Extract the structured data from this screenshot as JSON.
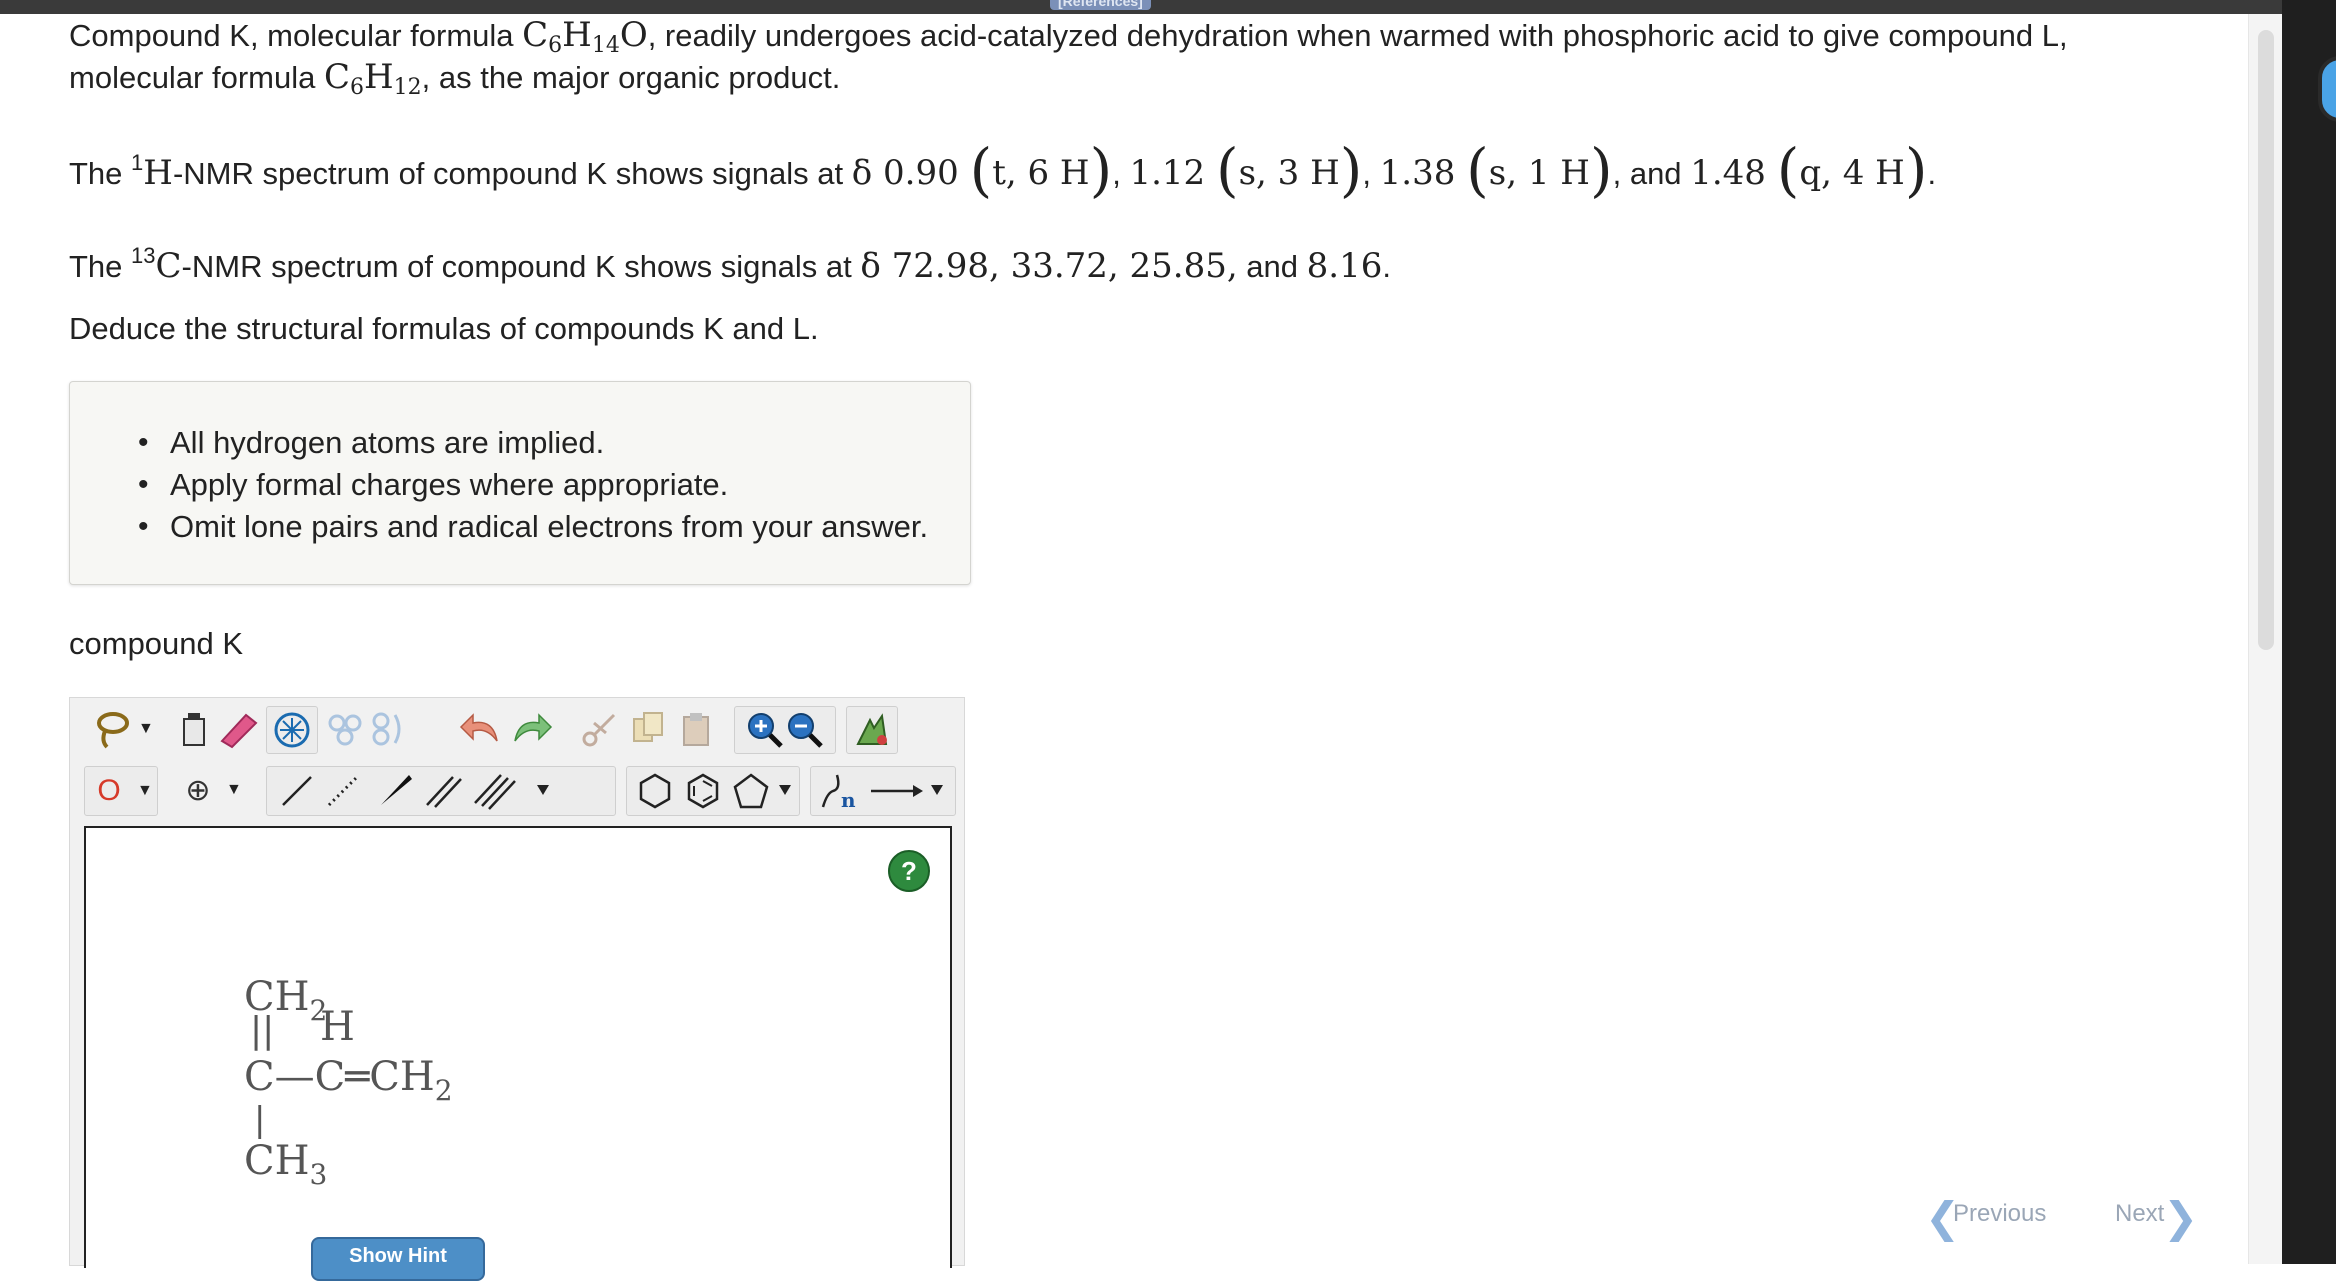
{
  "header": {
    "tab_label": "[References]"
  },
  "question": {
    "line1_a": "Compound K, molecular formula ",
    "line1_formula_C": "C",
    "line1_formula_C_sub": "6",
    "line1_formula_H": "H",
    "line1_formula_H_sub": "14",
    "line1_formula_O": "O",
    "line1_b": ", readily undergoes acid-catalyzed dehydration when warmed with phosphoric acid to give compound L,",
    "line2_a": "molecular formula ",
    "line2_formula_C": "C",
    "line2_formula_C_sub": "6",
    "line2_formula_H": "H",
    "line2_formula_H_sub": "12",
    "line2_b": ", as the major organic product.",
    "hnmr_prefix": "The ",
    "hnmr_sup": "1",
    "hnmr_nucleus": "H",
    "hnmr_text": "-NMR spectrum of compound K shows signals at ",
    "hnmr_signals": [
      {
        "shift": "δ 0.90",
        "mult": "t, 6 H"
      },
      {
        "shift": "1.12",
        "mult": "s, 3 H"
      },
      {
        "shift": "1.38",
        "mult": "s, 1 H"
      },
      {
        "shift": "1.48",
        "mult": "q, 4 H"
      }
    ],
    "hnmr_and": "and",
    "cnmr_prefix": "The ",
    "cnmr_sup": "13",
    "cnmr_nucleus": "C",
    "cnmr_text": "-NMR spectrum of compound K shows signals at ",
    "cnmr_values": "δ 72.98, 33.72, 25.85,",
    "cnmr_and": " and ",
    "cnmr_last": "8.16",
    "deduce": "Deduce the structural formulas of compounds K and L."
  },
  "instructions": [
    "All hydrogen atoms are implied.",
    "Apply formal charges where appropriate.",
    "Omit lone pairs and radical electrons from your answer."
  ],
  "compound_label": "compound K",
  "editor": {
    "atom_selector": "O",
    "charge_symbol": "⊕",
    "help": "?",
    "drawing": {
      "top": "CH",
      "top_sub": "2",
      "h_label": "H",
      "middle": "C—C═CH",
      "middle_sub": "2",
      "bottom": "CH",
      "bottom_sub": "3"
    },
    "hint_button": "Show Hint"
  },
  "nav": {
    "previous": "Previous",
    "next": "Next"
  }
}
